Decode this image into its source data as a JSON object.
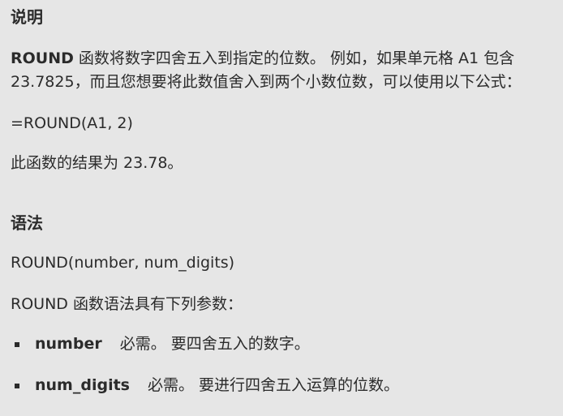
{
  "description": {
    "heading": "说明",
    "function_name": "ROUND",
    "text": " 函数将数字四舍五入到指定的位数。 例如，如果单元格 A1 包含 23.7825，而且您想要将此数值舍入到两个小数位数，可以使用以下公式：",
    "formula": "=ROUND(A1, 2)",
    "result": "此函数的结果为 23.78。"
  },
  "syntax": {
    "heading": "语法",
    "signature": "ROUND(number, num_digits)",
    "intro": "ROUND 函数语法具有下列参数：",
    "params": [
      {
        "name": "number",
        "desc": "必需。 要四舍五入的数字。"
      },
      {
        "name": "num_digits",
        "desc": "必需。 要进行四舍五入运算的位数。"
      }
    ]
  }
}
